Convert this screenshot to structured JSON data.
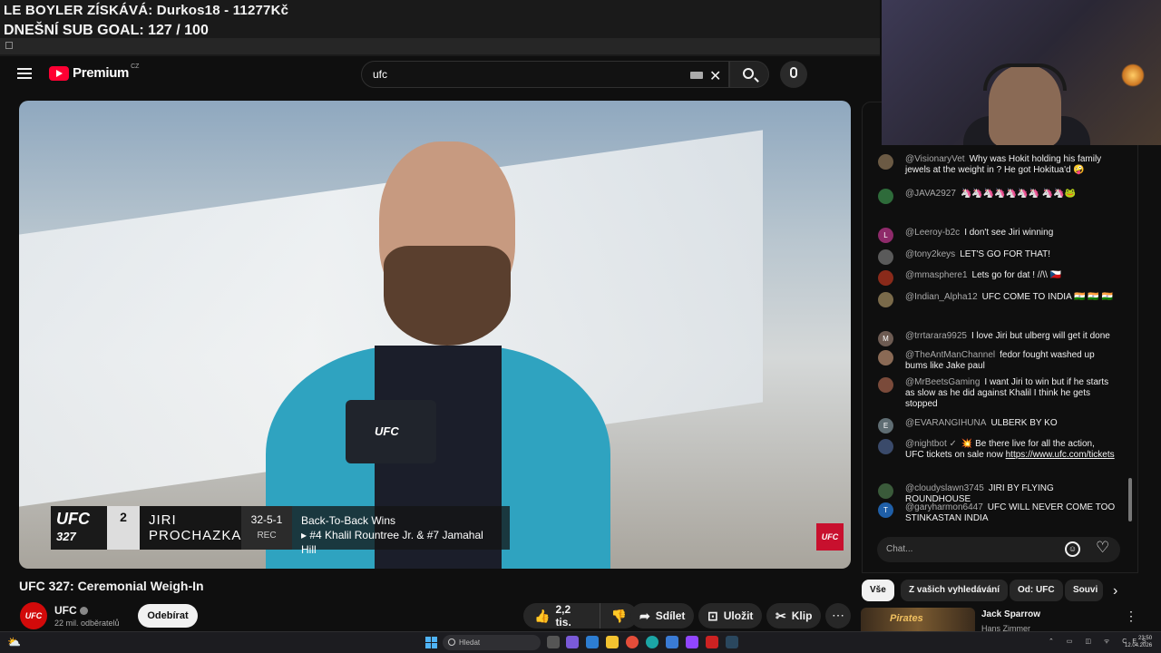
{
  "overlay": {
    "line1": "LE BOYLER ZÍSKÁVÁ: Durkos18 - 11277Kč",
    "line2": "DNEŠNÍ SUB GOAL: 127 / 100"
  },
  "header": {
    "logo_text": "Premium",
    "logo_region": "CZ",
    "search_value": "ufc"
  },
  "video": {
    "mic_label": "UFC",
    "lower_third": {
      "event": "UFC",
      "event_number": "327",
      "rank": "2",
      "first_name": "JIRI",
      "last_name": "PROCHAZKA",
      "record": "32-5-1",
      "record_label": "REC",
      "headline": "Back-To-Back Wins",
      "detail": "▸ #4 Khalil Rountree Jr. & #7 Jamahal Hill"
    },
    "corner_logo": "UFC",
    "title": "UFC 327: Ceremonial Weigh-In"
  },
  "channel": {
    "avatar_text": "UFC",
    "name": "UFC",
    "subscribers": "22 mil. odběratelů",
    "subscribe_label": "Odebírat"
  },
  "actions": {
    "like_count": "2,2 tis.",
    "share_label": "Sdílet",
    "save_label": "Uložit",
    "clip_label": "Klip",
    "more_label": "⋯"
  },
  "chat": {
    "messages": [
      {
        "author": "@VisionaryVet",
        "text": "Why was Hokit holding his family jewels at the weight in ? He got Hokitua'd 🤪",
        "avatar_color": "#6b5a44",
        "avatar_letter": ""
      },
      {
        "author": "@JAVA2927",
        "text": "🦄🦄🦄🦄🦄🦄🦄 🦄🦄🐸",
        "avatar_color": "#2e6b3a",
        "avatar_letter": ""
      },
      {
        "author": "@Leeroy-b2c",
        "text": "I don't see Jiri winning",
        "avatar_color": "#8e2a6a",
        "avatar_letter": "L"
      },
      {
        "author": "@tony2keys",
        "text": "LET'S GO FOR THAT!",
        "avatar_color": "#5a5a5a",
        "avatar_letter": ""
      },
      {
        "author": "@mmasphere1",
        "text": "Lets go for dat ! //\\\\ 🇨🇿",
        "avatar_color": "#8a2a1a",
        "avatar_letter": ""
      },
      {
        "author": "@Indian_Alpha12",
        "text": "UFC COME TO INDIA 🇮🇳 🇮🇳 🇮🇳",
        "avatar_color": "#7a6a4a",
        "avatar_letter": ""
      },
      {
        "author": "@trrtarara9925",
        "text": "I love Jiri but ulberg will get it done",
        "avatar_color": "#6d5b52",
        "avatar_letter": "M"
      },
      {
        "author": "@TheAntManChannel",
        "text": "fedor fought washed up bums like Jake paul",
        "avatar_color": "#8a6a55",
        "avatar_letter": ""
      },
      {
        "author": "@MrBeetsGaming",
        "text": "I want Jiri to win but if he starts as slow as he did against Khalil I think he gets stopped",
        "avatar_color": "#7a4a3a",
        "avatar_letter": ""
      },
      {
        "author": "@EVARANGIHUNA",
        "text": "ULBERK BY KO",
        "avatar_color": "#5f6d73",
        "avatar_letter": "E"
      },
      {
        "author": "@nightbot ✓",
        "text": "💥 Be there live for all the action, UFC tickets on sale now ",
        "link": "https://www.ufc.com/tickets",
        "avatar_color": "#3a4a6a",
        "avatar_letter": ""
      },
      {
        "author": "@cloudyslawn3745",
        "text": "JIRI BY FLYING ROUNDHOUSE",
        "avatar_color": "#3a5a3a",
        "avatar_letter": ""
      },
      {
        "author": "@garyharmon6447",
        "text": "UFC WILL NEVER COME TOO STINKASTAN INDIA",
        "avatar_color": "#1f5fa8",
        "avatar_letter": "T"
      }
    ],
    "input_placeholder": "Chat..."
  },
  "chips": [
    "Vše",
    "Z vašich vyhledávání",
    "Od: UFC",
    "Souvi"
  ],
  "recommendation": {
    "thumb_text": "Pirates",
    "title": "Jack Sparrow",
    "author": "Hans Zimmer"
  },
  "taskbar": {
    "search_placeholder": "Hledat",
    "tray_lang": "CES",
    "clock_time": "23:50",
    "clock_date": "12.04.2026"
  }
}
